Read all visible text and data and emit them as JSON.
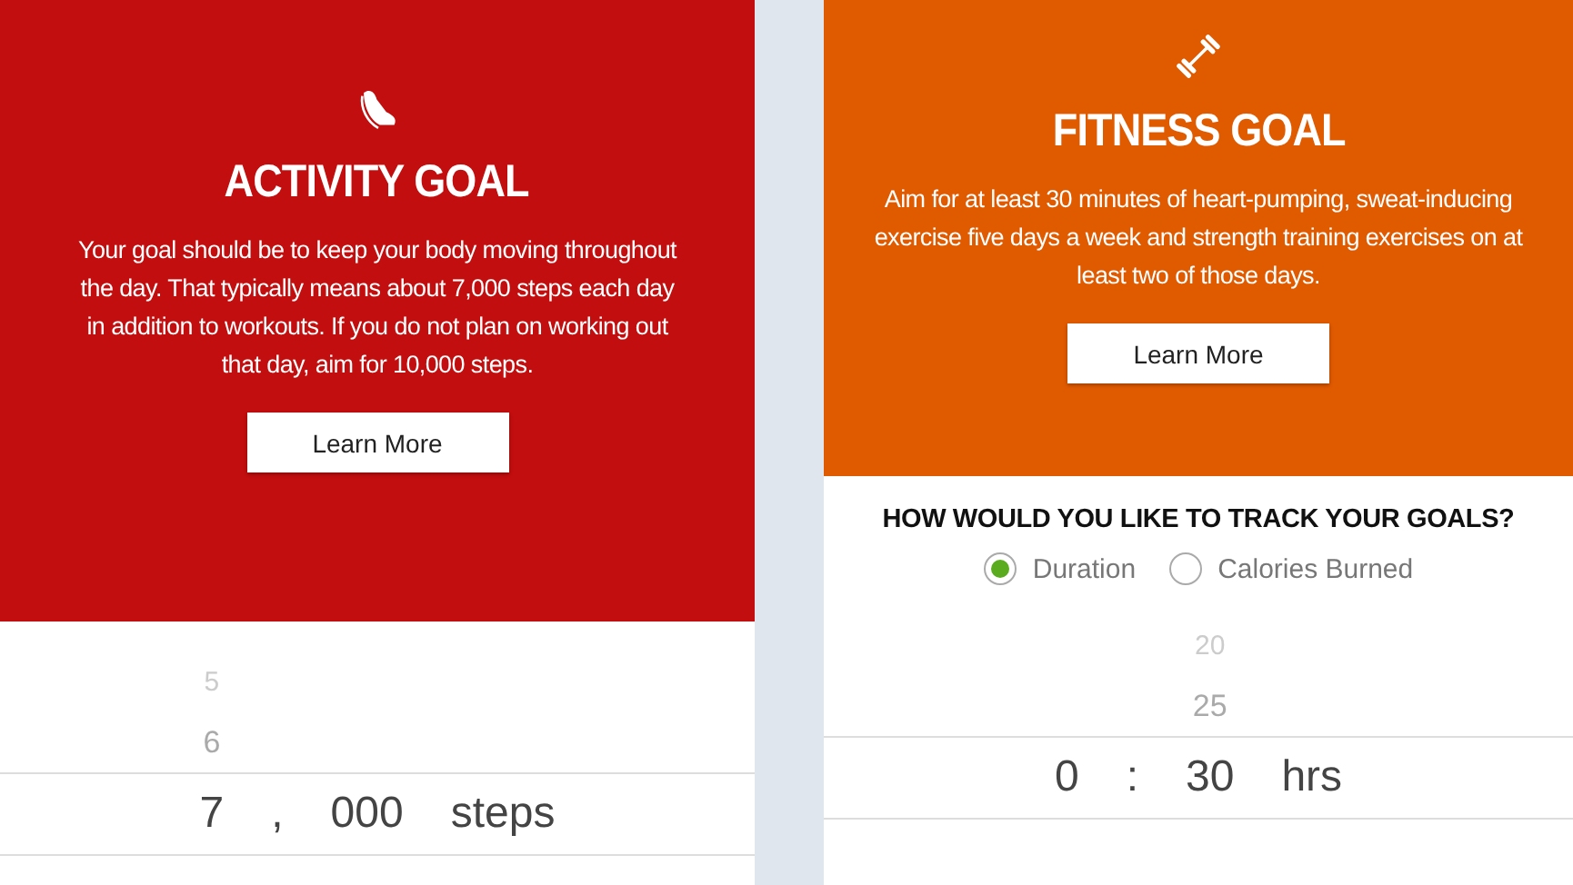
{
  "panels": [
    {
      "kind": "activity",
      "color": "#c20e0e",
      "title": "ACTIVITY GOAL",
      "text": "Your goal should be to keep your body moving throughout the day. That typically means about 7,000 steps each day in addition to workouts. If you do not plan on working out that day, aim for 10,000 steps.",
      "button": "Learn More",
      "picker": [
        {
          "kind": "wheel",
          "above": [
            "5",
            "6"
          ],
          "value": "7"
        },
        {
          "kind": "separator",
          "value": ","
        },
        {
          "kind": "wheel",
          "value": "000"
        },
        {
          "kind": "unit",
          "value": "steps"
        }
      ]
    },
    {
      "kind": "fitness",
      "color": "#e05a00",
      "title": "FITNESS GOAL",
      "text": "Aim for at least 30 minutes of heart-pumping, sweat-inducing exercise five days a week and strength training exercises on at least two of those days.",
      "button": "Learn More",
      "question": "HOW WOULD YOU LIKE TO TRACK YOUR GOALS?",
      "options": [
        {
          "label": "Duration",
          "selected": true
        },
        {
          "label": "Calories Burned",
          "selected": false
        }
      ],
      "picker": [
        {
          "kind": "wheel",
          "value": "0"
        },
        {
          "kind": "separator",
          "value": ":"
        },
        {
          "kind": "wheel",
          "above": [
            "20",
            "25"
          ],
          "value": "30"
        },
        {
          "kind": "unit",
          "value": "hrs"
        }
      ]
    }
  ]
}
